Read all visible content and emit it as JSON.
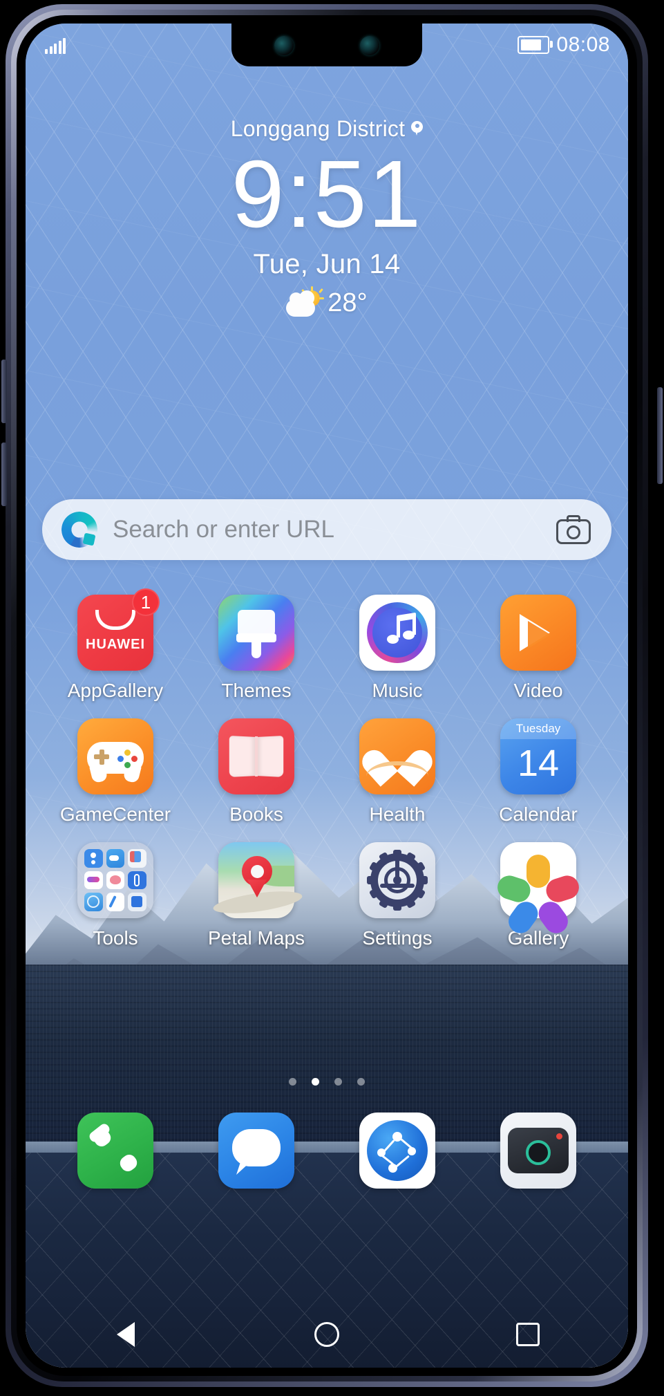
{
  "status_bar": {
    "signal_icon": "signal-bars-icon",
    "signal_bars": 5,
    "battery_icon": "battery-icon",
    "time": "08:08"
  },
  "clock_widget": {
    "location": "Longgang District",
    "location_pin_icon": "location-pin-icon",
    "time": "9:51",
    "date": "Tue, Jun 14",
    "weather_icon": "sun-behind-cloud-icon",
    "temperature": "28°"
  },
  "search": {
    "logo_icon": "petal-search-icon",
    "placeholder": "Search or enter URL",
    "value": "",
    "camera_icon": "camera-icon"
  },
  "app_grid": {
    "rows": [
      [
        {
          "label": "AppGallery",
          "icon": "appgallery-icon",
          "brand_text": "HUAWEI",
          "badge": "1"
        },
        {
          "label": "Themes",
          "icon": "themes-icon",
          "badge": ""
        },
        {
          "label": "Music",
          "icon": "music-icon",
          "badge": ""
        },
        {
          "label": "Video",
          "icon": "video-icon",
          "badge": ""
        }
      ],
      [
        {
          "label": "GameCenter",
          "icon": "gamecenter-icon",
          "badge": ""
        },
        {
          "label": "Books",
          "icon": "books-icon",
          "badge": ""
        },
        {
          "label": "Health",
          "icon": "health-icon",
          "badge": ""
        },
        {
          "label": "Calendar",
          "icon": "calendar-icon",
          "cal_weekday": "Tuesday",
          "cal_day": "14",
          "badge": ""
        }
      ],
      [
        {
          "label": "Tools",
          "icon": "tools-folder-icon",
          "badge": ""
        },
        {
          "label": "Petal Maps",
          "icon": "petal-maps-icon",
          "badge": ""
        },
        {
          "label": "Settings",
          "icon": "settings-gear-icon",
          "badge": ""
        },
        {
          "label": "Gallery",
          "icon": "gallery-icon",
          "badge": ""
        }
      ]
    ]
  },
  "page_indicator": {
    "total": 4,
    "active_index": 1
  },
  "dock": [
    {
      "name": "Phone",
      "icon": "phone-icon"
    },
    {
      "name": "Messages",
      "icon": "messages-icon"
    },
    {
      "name": "Browser",
      "icon": "browser-globe-icon"
    },
    {
      "name": "Camera",
      "icon": "camera-app-icon"
    }
  ],
  "nav_bar": [
    {
      "name": "Back",
      "icon": "back-triangle-icon"
    },
    {
      "name": "Home",
      "icon": "home-circle-icon"
    },
    {
      "name": "Recents",
      "icon": "recents-square-icon"
    }
  ],
  "colors": {
    "sky": "#7ea4de",
    "accent_red": "#ef3b44",
    "accent_orange": "#fb8a27",
    "accent_blue": "#2b84e6",
    "accent_green": "#2eb24a",
    "badge_red": "#f4313a"
  }
}
